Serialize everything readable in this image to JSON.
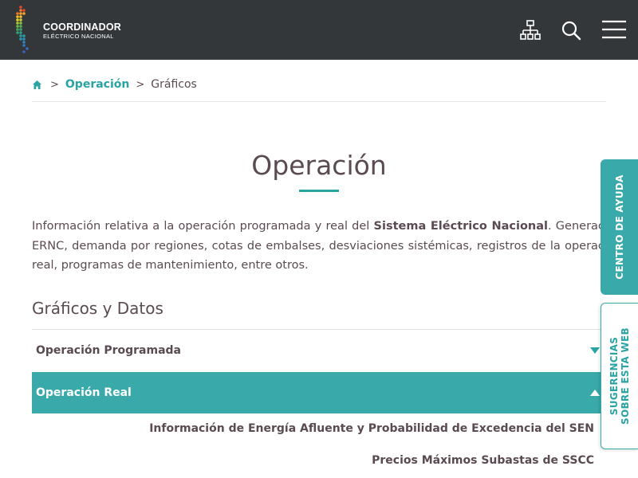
{
  "header": {
    "logo_line1": "COORDINADOR",
    "logo_line2": "ELÉCTRICO NACIONAL",
    "icons": [
      "sitemap-icon",
      "search-icon",
      "menu-icon"
    ]
  },
  "breadcrumb": {
    "sep1": ">",
    "link": "Operación",
    "sep2": ">",
    "current": "Gráficos"
  },
  "page": {
    "title": "Operación",
    "intro_before": "Información relativa a la operación programada y real del ",
    "intro_bold": "Sistema Eléctrico Nacional",
    "intro_after": ". Generación ERNC, demanda por regiones, cotas de embalses, desviaciones sistémicas, registros de la operación real, programas de mantenimiento, entre otros."
  },
  "section": {
    "title": "Gráficos y Datos",
    "accordion": [
      {
        "label": "Operación Programada",
        "state": "collapsed"
      },
      {
        "label": "Operación Real",
        "state": "expanded"
      }
    ],
    "links": [
      "Información de Energía Afluente y Probabilidad de Excedencia del SEN",
      "Precios Máximos Subastas de SSCC"
    ]
  },
  "side_tabs": {
    "help": "CENTRO DE AYUDA",
    "suggest_line1": "SUGERENCIAS",
    "suggest_line2": "SOBRE ESTA WEB"
  },
  "colors": {
    "header_bg": "#34373a",
    "accent": "#2aa3a3",
    "accent_fill": "#3aa9a9",
    "text": "#5a4a52"
  }
}
